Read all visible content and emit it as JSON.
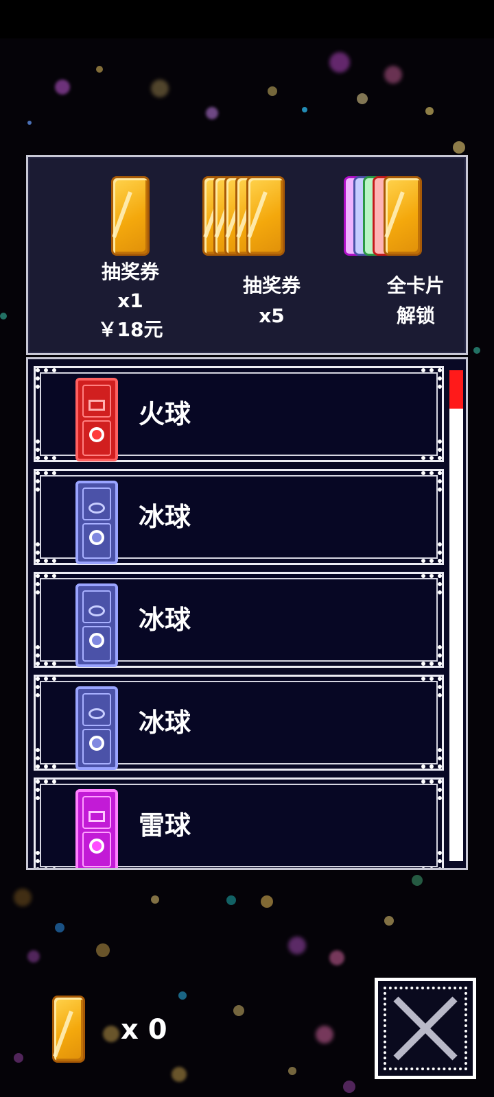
{
  "shop": {
    "items": [
      {
        "line1": "抽奖券",
        "line2": "x1",
        "line3": "￥18元",
        "icon": "single-ticket-icon"
      },
      {
        "line1": "抽奖券",
        "line2": "x5",
        "icon": "ticket-stack-icon"
      },
      {
        "line1": "全卡片",
        "line2": "解锁",
        "icon": "all-cards-icon"
      }
    ]
  },
  "cards": [
    {
      "name": "火球",
      "element": "fire"
    },
    {
      "name": "冰球",
      "element": "ice"
    },
    {
      "name": "冰球",
      "element": "ice"
    },
    {
      "name": "冰球",
      "element": "ice"
    },
    {
      "name": "雷球",
      "element": "thunder"
    }
  ],
  "footer": {
    "ticket_count": "x 0"
  },
  "colors": {
    "fire_card": "#d11f1f",
    "ice_card": "#4b52a8",
    "thunder_card": "#c21bd6",
    "ticket_gold": "#f4a80c",
    "scroll_thumb": "#ff1a1a"
  },
  "scroll": {
    "position": 0.0
  }
}
